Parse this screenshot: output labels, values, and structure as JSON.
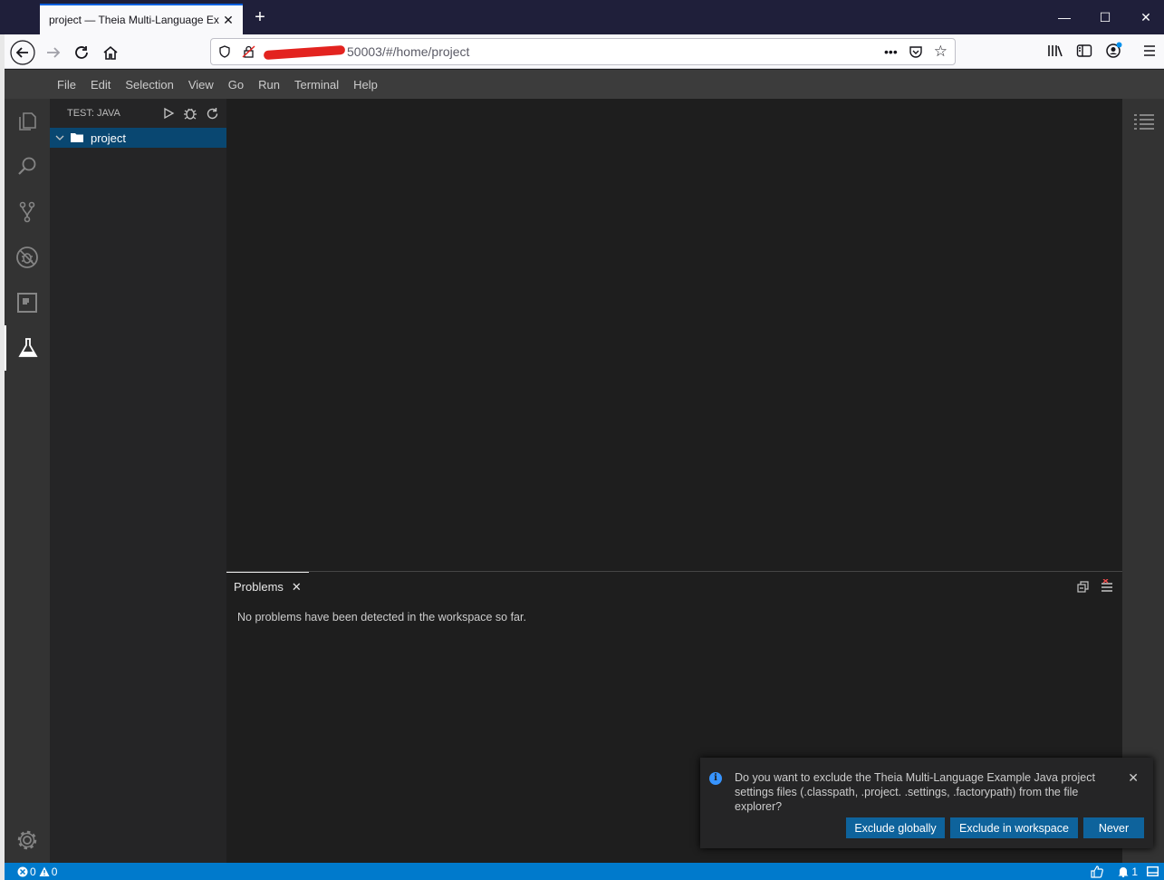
{
  "browser": {
    "tab_title": "project — Theia Multi-Language Ex",
    "tab_close": "✕",
    "new_tab": "+",
    "url_visible": "50003/#/home/project",
    "window_controls": {
      "minimize": "—",
      "maximize": "☐",
      "close": "✕"
    }
  },
  "menubar": {
    "items": [
      "File",
      "Edit",
      "Selection",
      "View",
      "Go",
      "Run",
      "Terminal",
      "Help"
    ]
  },
  "activity_bar": {
    "icons": [
      "explorer-icon",
      "search-icon",
      "source-control-icon",
      "debug-icon",
      "extensions-icon",
      "test-icon",
      "settings-gear-icon"
    ]
  },
  "sidebar": {
    "title": "TEST: JAVA",
    "tree": [
      {
        "label": "project",
        "expanded": true,
        "selected": true
      }
    ]
  },
  "panel": {
    "tab_label": "Problems",
    "tab_close": "✕",
    "message": "No problems have been detected in the workspace so far."
  },
  "notification": {
    "message": "Do you want to exclude the Theia Multi-Language Example Java project settings files (.classpath, .project. .settings, .factorypath) from the file explorer?",
    "close": "✕",
    "buttons": {
      "exclude_globally": "Exclude globally",
      "exclude_workspace": "Exclude in workspace",
      "never": "Never"
    }
  },
  "status_bar": {
    "errors": "0",
    "warnings": "0",
    "notifications": "1"
  },
  "colors": {
    "accent": "#007acc",
    "selection": "#094771",
    "button": "#0e639c",
    "redaction": "#e3231f"
  }
}
